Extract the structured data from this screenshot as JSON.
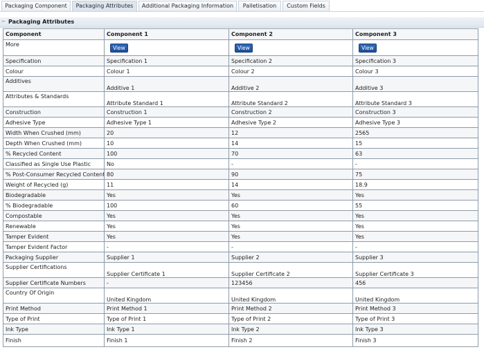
{
  "tabs": [
    {
      "label": "Packaging Component",
      "active": false
    },
    {
      "label": "Packaging Attributes",
      "active": true
    },
    {
      "label": "Additional Packaging Information",
      "active": false
    },
    {
      "label": "Palletisation",
      "active": false
    },
    {
      "label": "Custom Fields",
      "active": false
    }
  ],
  "section": {
    "title": "Packaging Attributes",
    "toggle": "−"
  },
  "table": {
    "headers": [
      "Component",
      "Component 1",
      "Component 2",
      "Component 3"
    ],
    "view_label": "View",
    "rows": [
      {
        "label": "More",
        "values": [
          "View",
          "View",
          "View"
        ],
        "button": true,
        "h": 20
      },
      {
        "label": "Specification",
        "values": [
          "Specification 1",
          "Specification 2",
          "Specification 3"
        ],
        "h": 14
      },
      {
        "label": "Colour",
        "values": [
          "Colour 1",
          "Colour 2",
          "Colour 3"
        ],
        "h": 14
      },
      {
        "label": "Additives",
        "values": [
          "Additive 1",
          "Additive 2",
          "Additive 3"
        ],
        "h": 19,
        "top": true
      },
      {
        "label": "Attributes & Standards",
        "values": [
          "Attribute Standard 1",
          "Attribute Standard 2",
          "Attribute Standard 3"
        ],
        "h": 19,
        "top": true
      },
      {
        "label": "Construction",
        "values": [
          "Construction 1",
          "Construction 2",
          "Construction 3"
        ],
        "h": 14
      },
      {
        "label": "Adhesive Type",
        "values": [
          "Adhesive Type 1",
          "Adhesive Type 2",
          "Adhesive Type 3"
        ],
        "h": 14
      },
      {
        "label": "Width When Crushed (mm)",
        "values": [
          "20",
          "12",
          "2565"
        ],
        "h": 14
      },
      {
        "label": "Depth When Crushed (mm)",
        "values": [
          "10",
          "14",
          "15"
        ],
        "h": 14
      },
      {
        "label": "% Recycled Content",
        "values": [
          "100",
          "70",
          "63"
        ],
        "h": 14
      },
      {
        "label": "Classified as Single Use Plastic",
        "values": [
          "No",
          "-",
          "-"
        ],
        "h": 14
      },
      {
        "label": "% Post-Consumer Recycled Content",
        "values": [
          "80",
          "90",
          "75"
        ],
        "h": 14
      },
      {
        "label": "Weight of Recycled (g)",
        "values": [
          "11",
          "14",
          "18.9"
        ],
        "h": 14
      },
      {
        "label": "Biodegradable",
        "values": [
          "Yes",
          "Yes",
          "Yes"
        ],
        "h": 14
      },
      {
        "label": "% Biodegradable",
        "values": [
          "100",
          "60",
          "55"
        ],
        "h": 14
      },
      {
        "label": "Compostable",
        "values": [
          "Yes",
          "Yes",
          "Yes"
        ],
        "h": 14
      },
      {
        "label": "Renewable",
        "values": [
          "Yes",
          "Yes",
          "Yes"
        ],
        "h": 14
      },
      {
        "label": "Tamper Evident",
        "values": [
          "Yes",
          "Yes",
          "Yes"
        ],
        "h": 14
      },
      {
        "label": "Tamper Evident Factor",
        "values": [
          "-",
          "-",
          "-"
        ],
        "h": 14
      },
      {
        "label": "Packaging Supplier",
        "values": [
          "Supplier 1",
          "Supplier 2",
          "Supplier 3"
        ],
        "h": 14
      },
      {
        "label": "Supplier Certifications",
        "values": [
          "Supplier Certificate 1",
          "Supplier Certificate 2",
          "Supplier Certificate 3"
        ],
        "h": 19,
        "top": true
      },
      {
        "label": "Supplier Certificate Numbers",
        "values": [
          "-",
          "123456",
          "456"
        ],
        "h": 14
      },
      {
        "label": "Country Of Origin",
        "values": [
          "United Kingdom",
          "United Kingdom",
          "United Kingdom"
        ],
        "h": 19,
        "top": true
      },
      {
        "label": "Print Method",
        "values": [
          "Print Method 1",
          "Print Method 2",
          "Print Method 3"
        ],
        "h": 14
      },
      {
        "label": "Type of Print",
        "values": [
          "Type of Print 1",
          "Type of Print 2",
          "Type of Print 3"
        ],
        "h": 14
      },
      {
        "label": "Ink Type",
        "values": [
          "Ink Type 1",
          "Ink Type 2",
          "Ink Type 3"
        ],
        "h": 14
      },
      {
        "label": "Finish",
        "values": [
          "Finish 1",
          "Finish 2",
          "Finish 3"
        ],
        "h": 17
      }
    ]
  }
}
